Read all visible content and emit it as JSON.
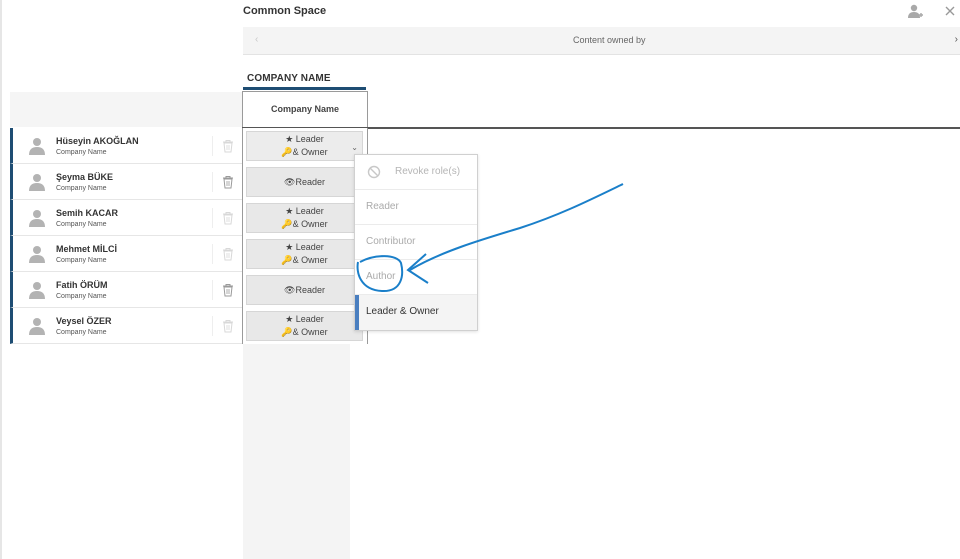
{
  "header": {
    "title": "Common Space"
  },
  "owned_bar": {
    "label": "Content owned by",
    "prev": "‹",
    "next": "›"
  },
  "company_tab": {
    "label": "COMPANY NAME"
  },
  "column_header": {
    "label": "Company Name"
  },
  "members": [
    {
      "name": "Hüseyin AKOĞLAN",
      "company": "Company Name",
      "role_line1": "★ Leader",
      "role_line2": "🔑& Owner",
      "two_line": true,
      "open": true
    },
    {
      "name": "Şeyma BÜKE",
      "company": "Company Name",
      "role_line1": "👁Reader",
      "role_line2": "",
      "two_line": false,
      "open": false
    },
    {
      "name": "Semih KACAR",
      "company": "Company Name",
      "role_line1": "★ Leader",
      "role_line2": "🔑& Owner",
      "two_line": true,
      "open": false
    },
    {
      "name": "Mehmet MİLCİ",
      "company": "Company Name",
      "role_line1": "★ Leader",
      "role_line2": "🔑& Owner",
      "two_line": true,
      "open": false
    },
    {
      "name": "Fatih ÖRÜM",
      "company": "Company Name",
      "role_line1": "👁Reader",
      "role_line2": "",
      "two_line": false,
      "open": false
    },
    {
      "name": "Veysel ÖZER",
      "company": "Company Name",
      "role_line1": "★ Leader",
      "role_line2": "🔑& Owner",
      "two_line": true,
      "open": false
    }
  ],
  "dropdown": {
    "items": [
      "Revoke role(s)",
      "Reader",
      "Contributor",
      "Author",
      "Leader & Owner"
    ],
    "selected": "Leader & Owner"
  },
  "icons": {
    "add_user": "add-user-icon",
    "close": "close-icon",
    "trash": "trash-icon",
    "avatar": "user-avatar-icon",
    "revoke": "ban-icon"
  },
  "colors": {
    "accent": "#1e4d73",
    "active_item": "#4a7fc0",
    "annotation": "#1a7fc9"
  }
}
